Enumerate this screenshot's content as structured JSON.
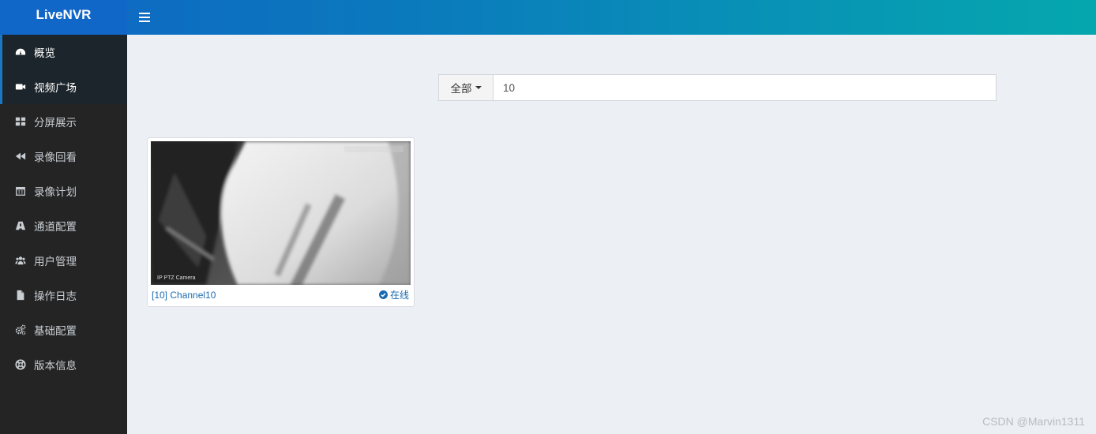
{
  "header": {
    "logo": "LiveNVR",
    "gradient_start": "#0f66c4",
    "gradient_end": "#05a7ae"
  },
  "sidebar": {
    "items": [
      {
        "label": "概览",
        "icon": "dashboard-icon"
      },
      {
        "label": "视频广场",
        "icon": "video-camera-icon"
      },
      {
        "label": "分屏展示",
        "icon": "grid-icon"
      },
      {
        "label": "录像回看",
        "icon": "rewind-icon"
      },
      {
        "label": "录像计划",
        "icon": "calendar-icon"
      },
      {
        "label": "通道配置",
        "icon": "channel-config-icon"
      },
      {
        "label": "用户管理",
        "icon": "users-icon"
      },
      {
        "label": "操作日志",
        "icon": "file-icon"
      },
      {
        "label": "基础配置",
        "icon": "gears-icon"
      },
      {
        "label": "版本信息",
        "icon": "lifebuoy-icon"
      }
    ]
  },
  "search": {
    "filter_label": "全部",
    "value": "10"
  },
  "channels": [
    {
      "title": "[10] Channel10",
      "status": "在线",
      "thumbnail_caption": "IP PTZ Camera",
      "status_color": "#1c6bb0"
    }
  ],
  "watermark": "CSDN @Marvin1311"
}
